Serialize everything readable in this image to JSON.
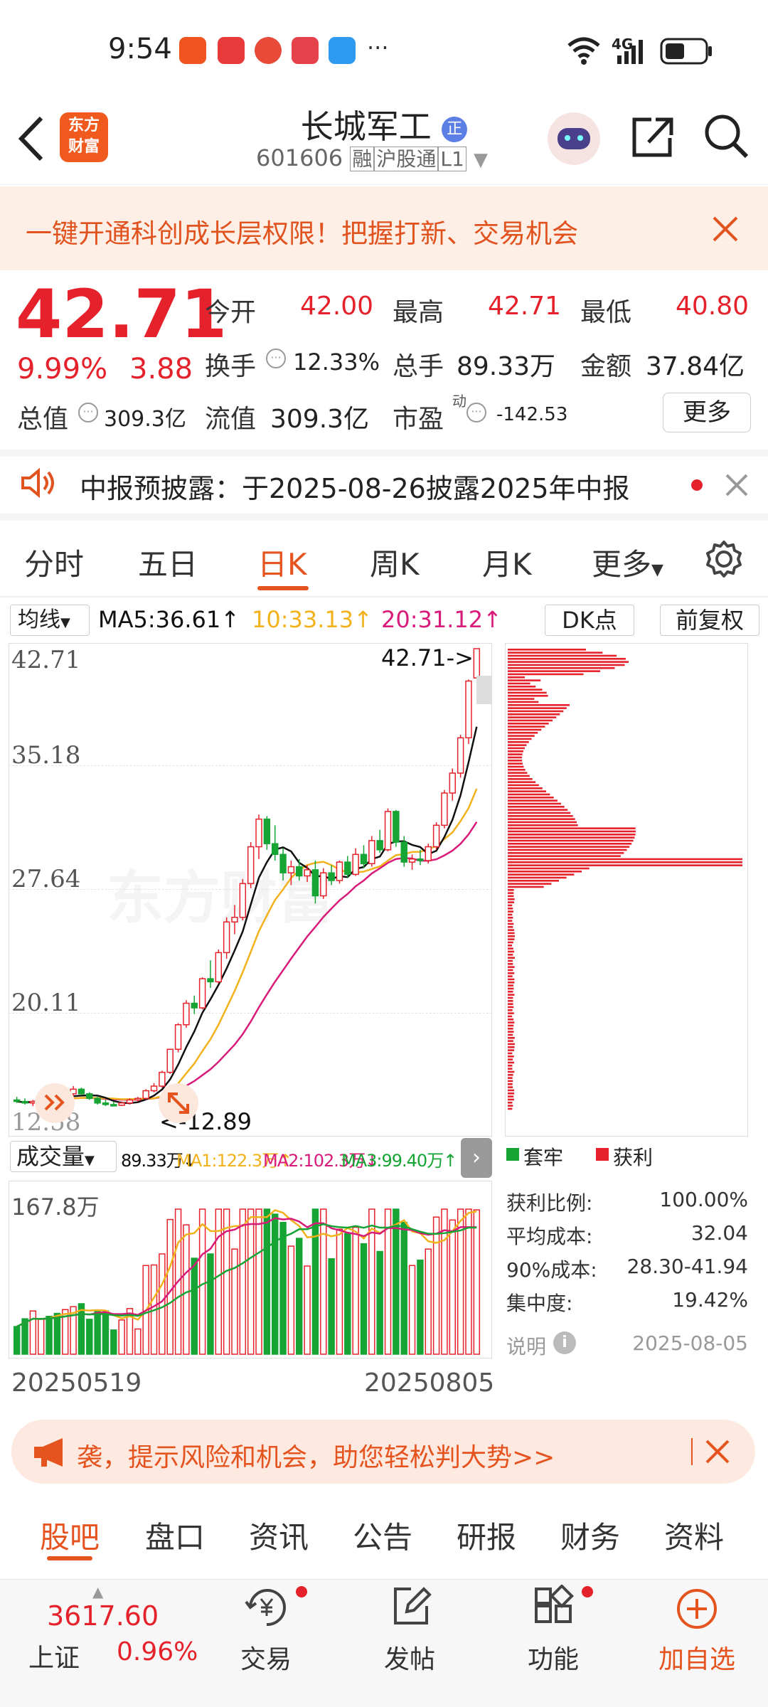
{
  "status_bar": {
    "time": "9:54",
    "network": "4G",
    "more": "···"
  },
  "header": {
    "logo_text": "东方\n财富",
    "title": "长城军工",
    "title_badge": "正",
    "code": "601606",
    "tags": [
      "融",
      "沪股通",
      "L1"
    ]
  },
  "promo": {
    "text": "一键开通科创成长层权限！把握打新、交易机会"
  },
  "quote": {
    "price": "42.71",
    "change_pct": "9.99%",
    "change": "3.88",
    "open_label": "今开",
    "open": "42.00",
    "high_label": "最高",
    "high": "42.71",
    "low_label": "最低",
    "low": "40.80",
    "turnover_label": "换手",
    "turnover": "12.33%",
    "volume_label": "总手",
    "volume": "89.33万",
    "amount_label": "金额",
    "amount": "37.84亿",
    "mktcap_label": "总值",
    "mktcap": "309.3亿",
    "float_label": "流值",
    "float": "309.3亿",
    "pe_label": "市盈",
    "pe_sup": "动",
    "pe": "-142.53",
    "more_button": "更多"
  },
  "notice": {
    "text": "中报预披露：于2025-08-26披露2025年中报"
  },
  "chart_tabs": [
    "分时",
    "五日",
    "日K",
    "周K",
    "月K",
    "更多"
  ],
  "active_tab": "日K",
  "ma_bar": {
    "selector": "均线",
    "ma5": "MA5:36.61",
    "ma10": "10:33.13",
    "ma20": "20:31.12",
    "dk": "DK点",
    "adjust": "前复权"
  },
  "colors": {
    "up": "#e5222b",
    "down": "#16a535",
    "ma5": "#111111",
    "ma10": "#f2b21c",
    "ma20": "#d81b7a",
    "accent": "#e5531f"
  },
  "price_axis": [
    "42.71",
    "35.18",
    "27.64",
    "20.11",
    "12.58"
  ],
  "price_marks": {
    "high": "42.71->",
    "low": "<-12.89"
  },
  "volume_bar": {
    "selector": "成交量",
    "vol": "89.33万",
    "ma1": "MA1:122.3万",
    "ma2": "MA2:102.3万",
    "ma3": "MA3:99.40万",
    "axis_max": "167.8万"
  },
  "dates": {
    "start": "20250519",
    "end": "20250805"
  },
  "chip": {
    "legend_down": "套牢",
    "legend_up": "获利",
    "profit_ratio_label": "获利比例:",
    "profit_ratio": "100.00%",
    "avg_cost_label": "平均成本:",
    "avg_cost": "32.04",
    "cost90_label": "90%成本:",
    "cost90": "28.30-41.94",
    "concentration_label": "集中度:",
    "concentration": "19.42%",
    "note_label": "说明",
    "date": "2025-08-05"
  },
  "ad_banner": {
    "text": "袭，提示风险和机会，助您轻松判大势>>"
  },
  "bottom_tabs": [
    "股吧",
    "盘口",
    "资讯",
    "公告",
    "研报",
    "财务",
    "资料"
  ],
  "bottom_bar": {
    "index_value": "3617.60",
    "index_name": "上证",
    "index_change": "0.96%",
    "trade": "交易",
    "post": "发帖",
    "func": "功能",
    "add": "加自选"
  },
  "chart_data": {
    "type": "candlestick",
    "x_start": "20250519",
    "x_end": "20250805",
    "ylim": [
      12.58,
      42.71
    ],
    "ohlc": [
      [
        13.3,
        13.5,
        13.1,
        13.2
      ],
      [
        13.2,
        13.4,
        13.0,
        13.1
      ],
      [
        13.1,
        13.3,
        12.9,
        13.2
      ],
      [
        13.2,
        13.6,
        13.1,
        13.5
      ],
      [
        13.5,
        13.6,
        13.2,
        13.3
      ],
      [
        13.3,
        13.4,
        13.1,
        13.2
      ],
      [
        13.2,
        13.8,
        13.1,
        13.7
      ],
      [
        13.7,
        14.2,
        13.5,
        14.0
      ],
      [
        14.0,
        14.1,
        13.6,
        13.7
      ],
      [
        13.7,
        13.8,
        13.3,
        13.4
      ],
      [
        13.4,
        13.5,
        13.0,
        13.1
      ],
      [
        13.1,
        13.3,
        12.9,
        13.0
      ],
      [
        13.0,
        13.2,
        12.89,
        12.95
      ],
      [
        12.95,
        13.2,
        12.9,
        13.1
      ],
      [
        13.1,
        13.4,
        13.0,
        13.3
      ],
      [
        13.3,
        13.5,
        13.2,
        13.4
      ],
      [
        13.4,
        14.0,
        13.3,
        13.9
      ],
      [
        13.9,
        14.4,
        13.8,
        14.2
      ],
      [
        14.2,
        15.2,
        14.1,
        15.1
      ],
      [
        15.1,
        16.6,
        15.0,
        16.6
      ],
      [
        16.6,
        18.3,
        16.4,
        18.2
      ],
      [
        18.2,
        19.8,
        18.0,
        19.6
      ],
      [
        19.6,
        20.1,
        18.9,
        19.3
      ],
      [
        19.3,
        21.3,
        19.2,
        21.2
      ],
      [
        21.2,
        22.4,
        20.6,
        21.0
      ],
      [
        21.0,
        23.1,
        20.9,
        22.9
      ],
      [
        22.9,
        25.2,
        22.5,
        24.9
      ],
      [
        24.9,
        26.0,
        24.1,
        25.2
      ],
      [
        25.2,
        27.7,
        25.0,
        27.4
      ],
      [
        27.4,
        30.1,
        27.1,
        29.8
      ],
      [
        29.8,
        31.9,
        29.0,
        31.6
      ],
      [
        31.6,
        31.8,
        29.6,
        30.0
      ],
      [
        30.0,
        31.2,
        28.9,
        29.3
      ],
      [
        29.3,
        29.7,
        27.6,
        28.1
      ],
      [
        28.1,
        28.9,
        27.3,
        28.5
      ],
      [
        28.5,
        29.0,
        27.6,
        27.9
      ],
      [
        27.9,
        28.6,
        27.5,
        28.3
      ],
      [
        28.3,
        28.9,
        26.1,
        26.6
      ],
      [
        26.6,
        28.4,
        26.4,
        28.1
      ],
      [
        28.1,
        28.6,
        27.3,
        27.6
      ],
      [
        27.6,
        28.9,
        27.4,
        28.8
      ],
      [
        28.8,
        29.2,
        27.8,
        28.0
      ],
      [
        28.0,
        29.7,
        27.9,
        29.3
      ],
      [
        29.3,
        29.9,
        28.4,
        28.7
      ],
      [
        28.7,
        30.5,
        28.5,
        30.2
      ],
      [
        30.2,
        30.9,
        29.4,
        29.6
      ],
      [
        29.6,
        32.3,
        29.5,
        32.1
      ],
      [
        32.1,
        32.2,
        29.8,
        30.1
      ],
      [
        30.1,
        30.5,
        28.5,
        28.8
      ],
      [
        28.8,
        29.3,
        28.3,
        29.0
      ],
      [
        29.0,
        29.6,
        28.6,
        28.9
      ],
      [
        28.9,
        30.0,
        28.7,
        29.8
      ],
      [
        29.8,
        31.4,
        29.6,
        31.2
      ],
      [
        31.2,
        33.5,
        31.0,
        33.3
      ],
      [
        33.3,
        34.9,
        32.8,
        34.6
      ],
      [
        34.6,
        37.1,
        34.3,
        36.9
      ],
      [
        36.9,
        40.7,
        36.5,
        40.6
      ],
      [
        40.8,
        42.71,
        40.8,
        42.71
      ]
    ],
    "volume_max_label": "167.8万"
  }
}
